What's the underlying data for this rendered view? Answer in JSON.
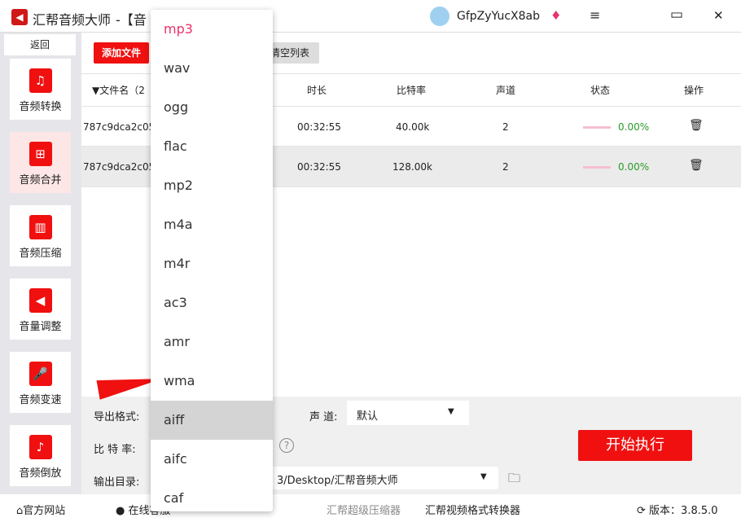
{
  "title": {
    "app": "汇帮音频大师",
    "suffix": "-【音",
    "user": "GfpZyYucX8ab",
    "minimize": "≡",
    "window": "▭",
    "close": "✕"
  },
  "sidebar": {
    "back": "返回",
    "items": [
      {
        "label": "音频转换",
        "icon": "♫"
      },
      {
        "label": "音频合并",
        "icon": "⊞"
      },
      {
        "label": "音频压缩",
        "icon": "▥"
      },
      {
        "label": "音量调整",
        "icon": "◀"
      },
      {
        "label": "音频变速",
        "icon": "🎤"
      },
      {
        "label": "音频倒放",
        "icon": "♪"
      }
    ]
  },
  "toolbar": {
    "add_file": "添加文件",
    "clear_list": "清空列表"
  },
  "table": {
    "headers": {
      "name": "▼文件名（2",
      "duration": "时长",
      "bitrate": "比特率",
      "channels": "声道",
      "status": "状态",
      "action": "操作"
    },
    "rows": [
      {
        "name": "787c9dca2c05",
        "duration": "00:32:55",
        "bitrate": "40.00k",
        "channels": "2",
        "progress": "0.00%"
      },
      {
        "name": "787c9dca2c05",
        "duration": "00:32:55",
        "bitrate": "128.00k",
        "channels": "2",
        "progress": "0.00%"
      }
    ]
  },
  "bottom": {
    "format_label": "导出格式:",
    "bitrate_label": "比 特 率:",
    "output_label": "输出目录:",
    "channel_label": "声 道:",
    "channel_value": "默认",
    "output_path": "3/Desktop/汇帮音频大师",
    "start": "开始执行"
  },
  "status": {
    "website": "官方网站",
    "support": "在线客服",
    "compressor": "汇帮超级压缩器",
    "video_converter": "汇帮视频格式转换器",
    "version": "版本：3.8.5.0"
  },
  "dropdown": {
    "options": [
      "mp3",
      "wav",
      "ogg",
      "flac",
      "mp2",
      "m4a",
      "m4r",
      "ac3",
      "amr",
      "wma",
      "aiff",
      "aifc",
      "caf"
    ],
    "selected": "mp3",
    "hovered": "aiff"
  },
  "colors": {
    "accent": "#f01010",
    "progress": "#2a9a2a"
  }
}
